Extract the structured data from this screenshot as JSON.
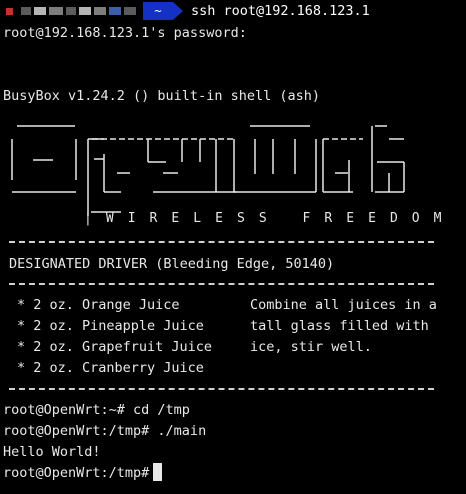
{
  "prompt_bar": {
    "tilde": "~",
    "command": "ssh root@192.168.123.1",
    "accent_color": "#1431c4",
    "status_color": "#c9302c"
  },
  "session": {
    "password_prompt": "root@192.168.123.1's password:",
    "shell_banner": "BusyBox v1.24.2 () built-in shell (ash)",
    "logo_text": "OpenWrt",
    "tagline": "| W I R E L E S S   F R E E D O M",
    "release": "DESIGNATED DRIVER (Bleeding Edge, 50140)",
    "recipe": [
      "* 2 oz. Orange Juice",
      "* 2 oz. Pineapple Juice",
      "* 2 oz. Grapefruit Juice",
      "* 2 oz. Cranberry Juice"
    ],
    "instructions": [
      "Combine all juices in a",
      "tall glass filled with",
      "ice, stir well."
    ],
    "commands": [
      "root@OpenWrt:~# cd /tmp",
      "root@OpenWrt:/tmp# ./main",
      "Hello World!",
      "root@OpenWrt:/tmp# "
    ]
  }
}
